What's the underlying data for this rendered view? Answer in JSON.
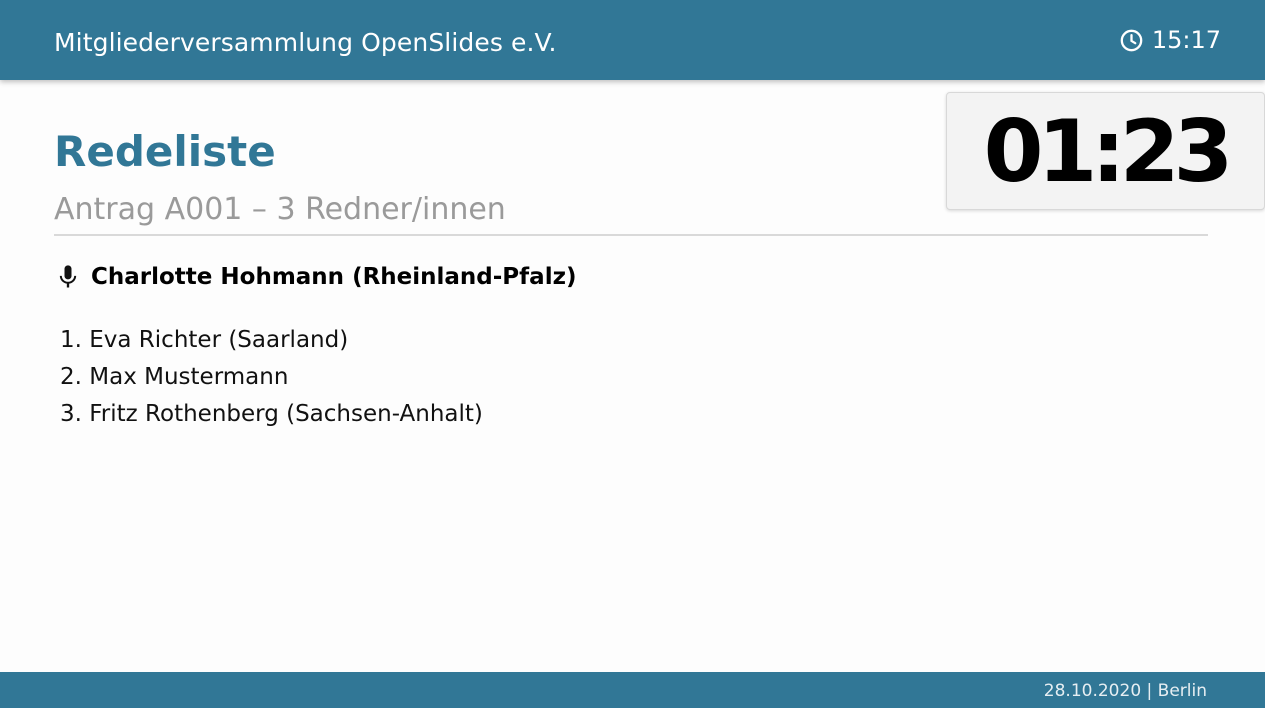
{
  "header": {
    "title": "Mitgliederversammlung OpenSlides e.V.",
    "clock_icon": "clock-icon",
    "time": "15:17"
  },
  "countdown": {
    "value": "01:23"
  },
  "slide": {
    "title": "Redeliste",
    "subtitle": "Antrag A001 – 3 Redner/innen"
  },
  "current_speaker": {
    "icon": "microphone-icon",
    "name": "Charlotte Hohmann (Rheinland-Pfalz)"
  },
  "waiting_list": [
    "1. Eva Richter (Saarland)",
    "2. Max Mustermann",
    "3. Fritz Rothenberg (Sachsen-Anhalt)"
  ],
  "footer": {
    "text": "28.10.2020 | Berlin"
  },
  "colors": {
    "brand": "#317796",
    "subtitle": "#9a9a9a",
    "countdown_bg": "#f3f3f3"
  }
}
